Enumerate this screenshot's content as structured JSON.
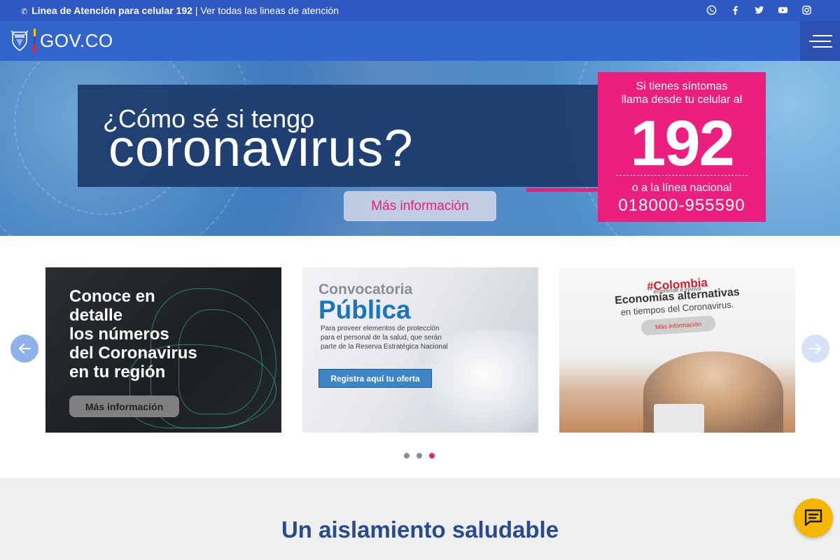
{
  "topbar": {
    "phone_label": "Linea de Atención para celular 192",
    "separator": "|",
    "link_label": "Ver todas las lineas de atención",
    "social": [
      "whatsapp-icon",
      "facebook-icon",
      "twitter-icon",
      "youtube-icon",
      "instagram-icon"
    ]
  },
  "header": {
    "logo_text": "GOV.CO",
    "menu_icon": "hamburger-icon"
  },
  "hero": {
    "question_line1": "¿Cómo sé si tengo",
    "question_line2": "coronavirus?",
    "button_label": "Más información",
    "symptom_line1": "Si tienes síntomas",
    "symptom_line2": "llama desde tu celular al",
    "number": "192",
    "national_label": "o a la línea nacional",
    "national_number": "018000-955590"
  },
  "carousel": {
    "slide1": {
      "line1": "Conoce en",
      "line2": "detalle",
      "line3": "los números",
      "line4": "del Coronavirus",
      "line5": "en tu región",
      "button": "Más información"
    },
    "slide2": {
      "title1": "Convocatoria",
      "title2": "Pública",
      "body": "Para proveer elementos de protección para el personal de la salud, que serán parte de la Reserva Estratégica Nacional",
      "button": "Registra aquí tu oferta"
    },
    "slide3": {
      "brand": "#Colombia",
      "brand_sub": "emprende e innova",
      "title1": "Economías alternativas",
      "title2": "en tiempos del Coronavirus.",
      "button": "Más información"
    },
    "active_dot": 3,
    "dot_count": 3
  },
  "section": {
    "title": "Un aislamiento saludable"
  },
  "colors": {
    "topbar": "#2f59c2",
    "header": "#3366cc",
    "accent_pink": "#ec1f7e",
    "title_blue": "#284b8f",
    "chat_yellow": "#f6b700"
  }
}
